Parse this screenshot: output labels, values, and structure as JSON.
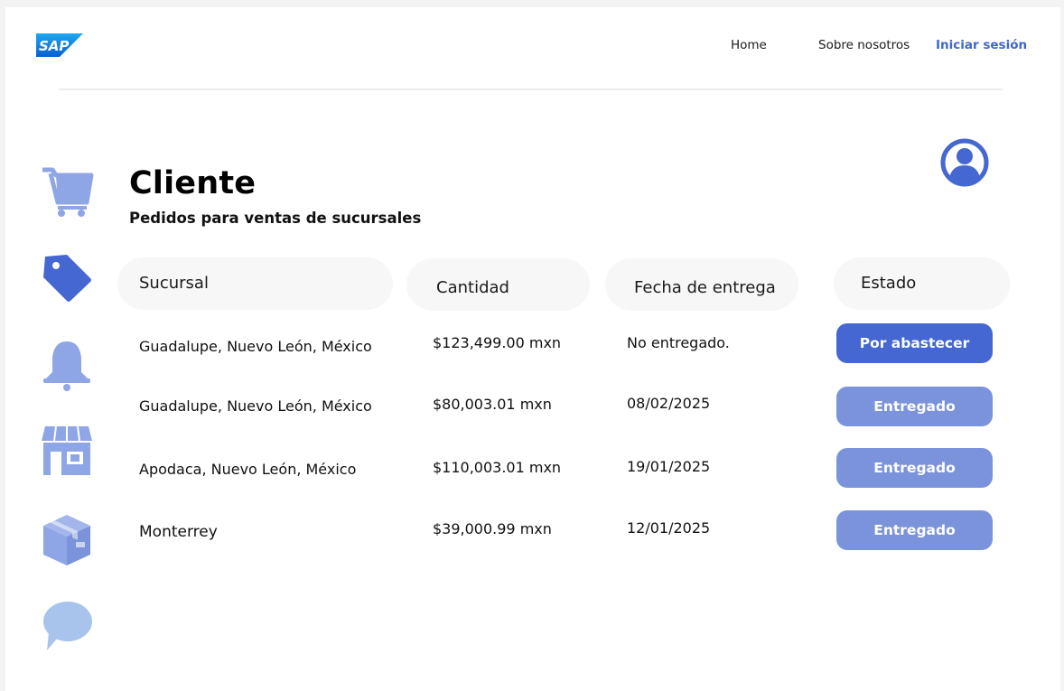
{
  "header": {
    "logo_text": "SAP",
    "nav": {
      "home": "Home",
      "about": "Sobre nosotros",
      "login": "Iniciar sesión"
    }
  },
  "page": {
    "title": "Cliente",
    "subtitle": "Pedidos para ventas de sucursales"
  },
  "sidebar": {
    "icons": [
      "cart-icon",
      "tag-icon",
      "bell-icon",
      "store-icon",
      "box-icon",
      "chat-icon"
    ]
  },
  "table": {
    "headers": {
      "branch": "Sucursal",
      "amount": "Cantidad",
      "delivery_date": "Fecha de entrega",
      "status": "Estado"
    },
    "rows": [
      {
        "branch": "Guadalupe, Nuevo León, México",
        "amount": "$123,499.00 mxn",
        "delivery_date": "No entregado.",
        "status": "Por abastecer"
      },
      {
        "branch": "Guadalupe, Nuevo León, México",
        "amount": "$80,003.01 mxn",
        "delivery_date": "08/02/2025",
        "status": "Entregado"
      },
      {
        "branch": "Apodaca, Nuevo León, México",
        "amount": "$110,003.01 mxn",
        "delivery_date": "19/01/2025",
        "status": "Entregado"
      },
      {
        "branch": "Monterrey",
        "amount": "$39,000.99 mxn",
        "delivery_date": "12/01/2025",
        "status": "Entregado"
      }
    ]
  },
  "colors": {
    "primary": "#4467d1",
    "delivered": "#7b93da",
    "icon_light": "#8fa6e6",
    "chat": "#a9c4ec"
  }
}
